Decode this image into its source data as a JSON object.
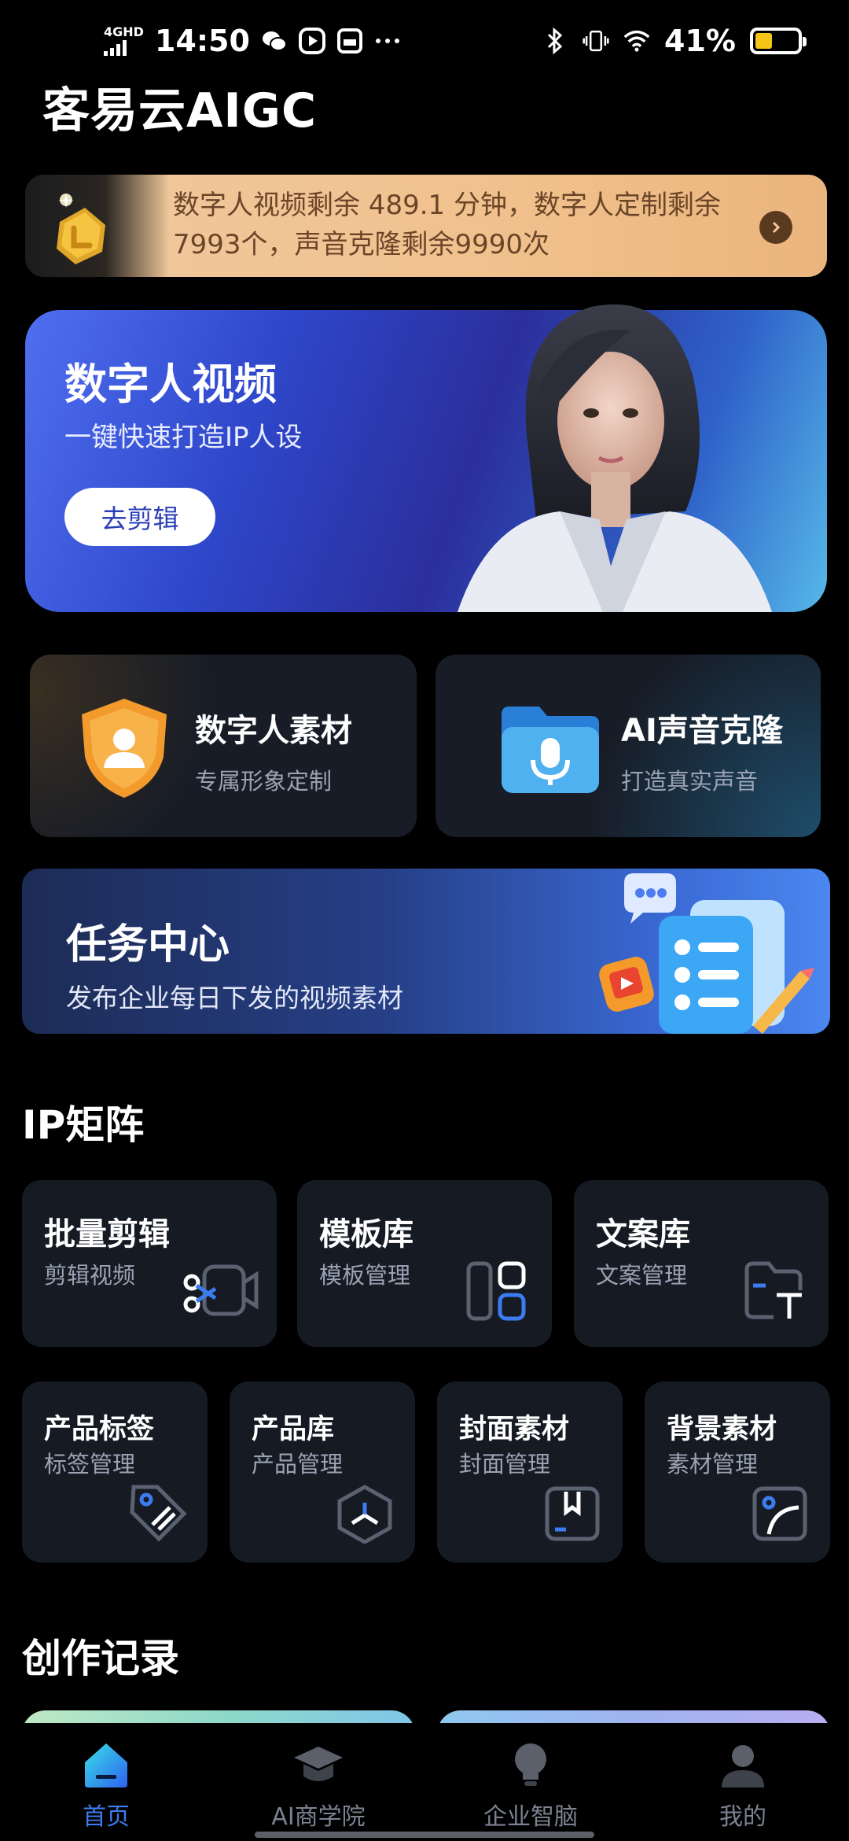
{
  "status_bar": {
    "network": "4GHD",
    "time": "14:50",
    "battery_percent": "41%",
    "battery_level": 0.41,
    "battery_color": "#f5c518",
    "icons": [
      "wechat-icon",
      "video-icon",
      "sim-card-icon",
      "more-icon",
      "bluetooth-icon",
      "vibrate-icon",
      "wifi-icon"
    ]
  },
  "app": {
    "title": "客易云AIGC"
  },
  "quota": {
    "text": "数字人视频剩余 489.1 分钟，数字人定制剩余7993个，声音克隆剩余9990次",
    "icon": "gold-medal-icon"
  },
  "hero": {
    "title": "数字人视频",
    "subtitle": "一键快速打造IP人设",
    "button": "去剪辑"
  },
  "features": [
    {
      "title": "数字人素材",
      "subtitle": "专属形象定制",
      "icon": "shield-person-icon"
    },
    {
      "title": "AI声音克隆",
      "subtitle": "打造真实声音",
      "icon": "folder-mic-icon"
    }
  ],
  "task_center": {
    "title": "任务中心",
    "subtitle": "发布企业每日下发的视频素材"
  },
  "ip_matrix": {
    "title": "IP矩阵",
    "row1": [
      {
        "title": "批量剪辑",
        "subtitle": "剪辑视频",
        "icon": "scissors-camera-icon"
      },
      {
        "title": "模板库",
        "subtitle": "模板管理",
        "icon": "template-layout-icon"
      },
      {
        "title": "文案库",
        "subtitle": "文案管理",
        "icon": "text-folder-icon"
      }
    ],
    "row2": [
      {
        "title": "产品标签",
        "subtitle": "标签管理",
        "icon": "tag-icon"
      },
      {
        "title": "产品库",
        "subtitle": "产品管理",
        "icon": "hexagon-product-icon"
      },
      {
        "title": "封面素材",
        "subtitle": "封面管理",
        "icon": "cover-image-icon"
      },
      {
        "title": "背景素材",
        "subtitle": "素材管理",
        "icon": "background-image-icon"
      }
    ]
  },
  "records": {
    "title": "创作记录"
  },
  "tabs": [
    {
      "label": "首页",
      "active": true,
      "icon": "home-icon"
    },
    {
      "label": "AI商学院",
      "active": false,
      "icon": "graduation-cap-icon"
    },
    {
      "label": "企业智脑",
      "active": false,
      "icon": "lightbulb-icon"
    },
    {
      "label": "我的",
      "active": false,
      "icon": "user-icon"
    }
  ],
  "colors": {
    "accent": "#3d7cf0",
    "card_bg": "#151a23",
    "quota_text": "#6b4528"
  }
}
